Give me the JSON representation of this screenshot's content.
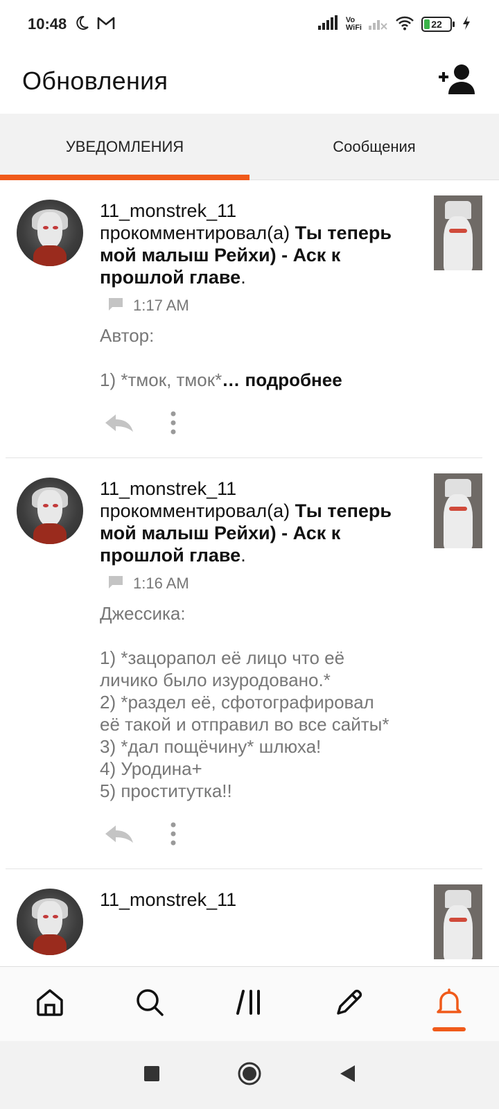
{
  "status_bar": {
    "time": "10:48",
    "battery": "22",
    "icons": [
      "moon-icon",
      "gmail-icon",
      "signal-icon",
      "vowifi-icon",
      "signal-off-icon",
      "wifi-icon",
      "battery-icon",
      "charging-icon"
    ],
    "vowifi_top": "Vo",
    "vowifi_bottom": "WiFi"
  },
  "header": {
    "title": "Обновления",
    "action_icon": "add-person-icon"
  },
  "tabs": [
    {
      "label": "УВЕДОМЛЕНИЯ",
      "active": true
    },
    {
      "label": "Сообщения",
      "active": false
    }
  ],
  "notifications": [
    {
      "username": "11_monstrek_11",
      "verb": "прокомментировал(а) ",
      "story_title": "Ты теперь мой малыш Рейхи) - Аск к прошлой главе",
      "period": ".",
      "time": "1:17 AM",
      "comment": "Автор:\n\n1) *тмок, тмок*",
      "read_more": "… подробнее"
    },
    {
      "username": "11_monstrek_11",
      "verb": "прокомментировал(а) ",
      "story_title": "Ты теперь мой малыш Рейхи) - Аск к прошлой главе",
      "period": ".",
      "time": "1:16 AM",
      "comment": "Джессика:\n\n1) *зацорапол её лицо что её личико было изуродовано.*\n2) *раздел её, сфотографировал её такой и отправил во все сайты*\n3) *дал пощёчину* шлюха!\n4) Уродина+\n5) проститутка!!",
      "read_more": ""
    },
    {
      "username": "11_monstrek_11"
    }
  ],
  "bottom_nav": [
    "home-icon",
    "search-icon",
    "library-icon",
    "write-icon",
    "notifications-icon"
  ],
  "system_nav": [
    "recents-icon",
    "home-circle-icon",
    "back-icon"
  ],
  "colors": {
    "accent": "#f05a1a",
    "text": "#121212",
    "muted": "#777777"
  }
}
